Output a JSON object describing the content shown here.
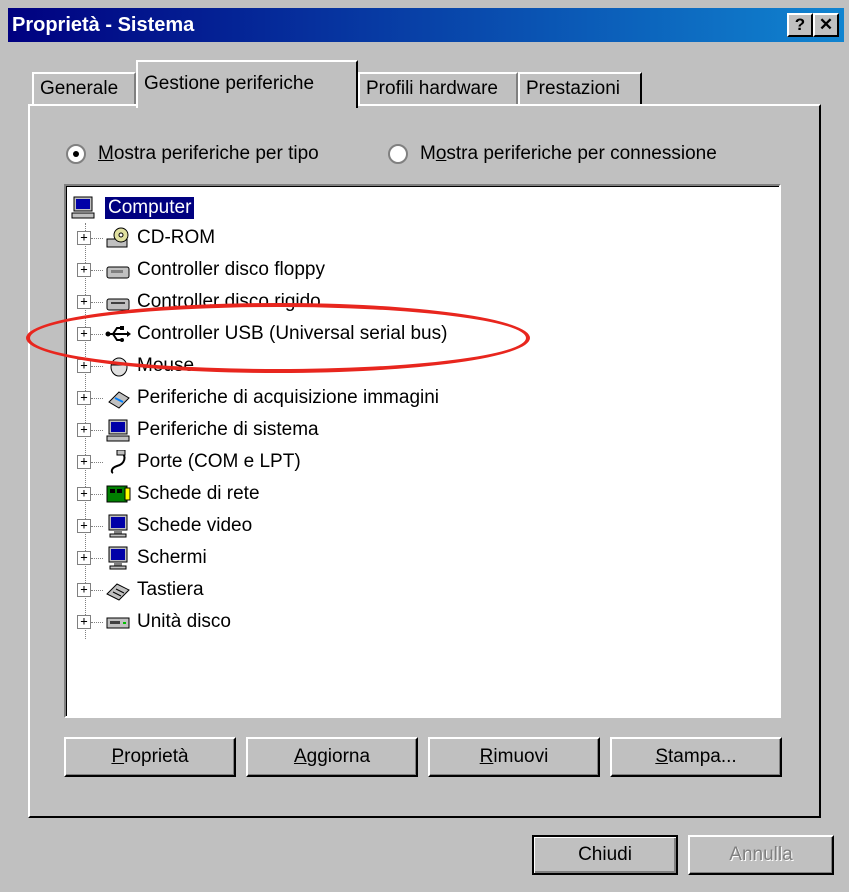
{
  "window": {
    "title": "Proprietà - Sistema",
    "help_label": "?",
    "close_label": "✕"
  },
  "tabs": [
    {
      "label": "Generale"
    },
    {
      "label": "Gestione periferiche"
    },
    {
      "label": "Profili hardware"
    },
    {
      "label": "Prestazioni"
    }
  ],
  "view_options": {
    "by_type": {
      "prefix": "",
      "accel": "M",
      "rest": "ostra periferiche per tipo",
      "checked": true
    },
    "by_connection": {
      "prefix": "M",
      "accel": "o",
      "rest": "stra periferiche per connessione",
      "checked": false
    }
  },
  "tree": {
    "root": "Computer",
    "items": [
      {
        "label": "CD-ROM",
        "icon": "cdrom-icon"
      },
      {
        "label": "Controller disco floppy",
        "icon": "floppy-controller-icon"
      },
      {
        "label": "Controller disco rigido",
        "icon": "hard-disk-controller-icon"
      },
      {
        "label": "Controller USB (Universal serial bus)",
        "icon": "usb-icon"
      },
      {
        "label": "Mouse",
        "icon": "mouse-icon"
      },
      {
        "label": "Periferiche di acquisizione immagini",
        "icon": "scanner-icon"
      },
      {
        "label": "Periferiche di sistema",
        "icon": "system-devices-icon"
      },
      {
        "label": "Porte (COM e LPT)",
        "icon": "port-icon"
      },
      {
        "label": "Schede di rete",
        "icon": "network-card-icon"
      },
      {
        "label": "Schede video",
        "icon": "display-adapter-icon"
      },
      {
        "label": "Schermi",
        "icon": "monitor-icon"
      },
      {
        "label": "Tastiera",
        "icon": "keyboard-icon"
      },
      {
        "label": "Unità disco",
        "icon": "disk-drive-icon"
      }
    ]
  },
  "buttons": {
    "properties": {
      "accel": "P",
      "rest": "roprietà"
    },
    "refresh": {
      "accel": "A",
      "rest": "ggiorna"
    },
    "remove": {
      "accel": "R",
      "rest": "imuovi"
    },
    "print": {
      "accel": "S",
      "rest": "tampa..."
    },
    "close": "Chiudi",
    "cancel": "Annulla"
  },
  "colors": {
    "titlebar": "#000080",
    "selection": "#000080",
    "highlight_ellipse": "#e8261e"
  }
}
